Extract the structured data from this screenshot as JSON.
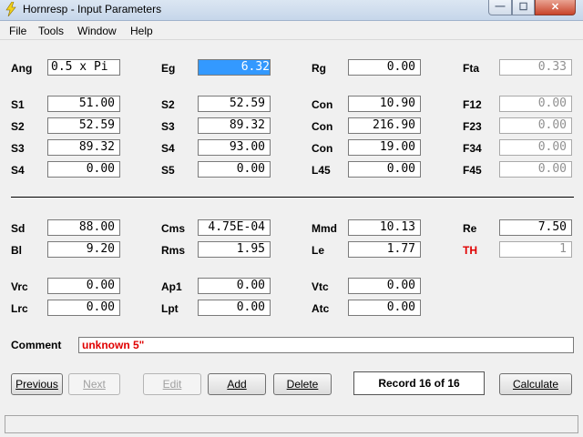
{
  "window": {
    "title": "Hornresp - Input Parameters"
  },
  "menu": [
    "File",
    "Tools",
    "Window",
    "Help"
  ],
  "fields": {
    "ang": {
      "label": "Ang",
      "value": "0.5 x Pi"
    },
    "eg": {
      "label": "Eg",
      "value": "6.32"
    },
    "rg": {
      "label": "Rg",
      "value": "0.00"
    },
    "fta": {
      "label": "Fta",
      "value": "0.33"
    },
    "s1": {
      "label": "S1",
      "value": "51.00"
    },
    "s2a": {
      "label": "S2",
      "value": "52.59"
    },
    "con1": {
      "label": "Con",
      "value": "10.90"
    },
    "f12": {
      "label": "F12",
      "value": "0.00"
    },
    "s2b": {
      "label": "S2",
      "value": "52.59"
    },
    "s3a": {
      "label": "S3",
      "value": "89.32"
    },
    "con2": {
      "label": "Con",
      "value": "216.90"
    },
    "f23": {
      "label": "F23",
      "value": "0.00"
    },
    "s3b": {
      "label": "S3",
      "value": "89.32"
    },
    "s4a": {
      "label": "S4",
      "value": "93.00"
    },
    "con3": {
      "label": "Con",
      "value": "19.00"
    },
    "f34": {
      "label": "F34",
      "value": "0.00"
    },
    "s4b": {
      "label": "S4",
      "value": "0.00"
    },
    "s5": {
      "label": "S5",
      "value": "0.00"
    },
    "l45": {
      "label": "L45",
      "value": "0.00"
    },
    "f45": {
      "label": "F45",
      "value": "0.00"
    },
    "sd": {
      "label": "Sd",
      "value": "88.00"
    },
    "cms": {
      "label": "Cms",
      "value": "4.75E-04"
    },
    "mmd": {
      "label": "Mmd",
      "value": "10.13"
    },
    "re": {
      "label": "Re",
      "value": "7.50"
    },
    "bl": {
      "label": "Bl",
      "value": "9.20"
    },
    "rms": {
      "label": "Rms",
      "value": "1.95"
    },
    "le": {
      "label": "Le",
      "value": "1.77"
    },
    "th": {
      "label": "TH",
      "value": "1"
    },
    "vrc": {
      "label": "Vrc",
      "value": "0.00"
    },
    "ap1": {
      "label": "Ap1",
      "value": "0.00"
    },
    "vtc": {
      "label": "Vtc",
      "value": "0.00"
    },
    "lrc": {
      "label": "Lrc",
      "value": "0.00"
    },
    "lpt": {
      "label": "Lpt",
      "value": "0.00"
    },
    "atc": {
      "label": "Atc",
      "value": "0.00"
    }
  },
  "comment": {
    "label": "Comment",
    "value": "unknown 5\""
  },
  "buttons": {
    "previous": "Previous",
    "next": "Next",
    "edit": "Edit",
    "add": "Add",
    "delete": "Delete",
    "calculate": "Calculate"
  },
  "record": "Record 16 of 16",
  "colors": {
    "selection": "#3399ff",
    "th_label": "#e00000",
    "comment_text": "#e00000"
  },
  "icons": {
    "app": "lightning-icon",
    "minimize": "minimize-icon",
    "maximize": "maximize-icon",
    "close": "close-icon"
  }
}
